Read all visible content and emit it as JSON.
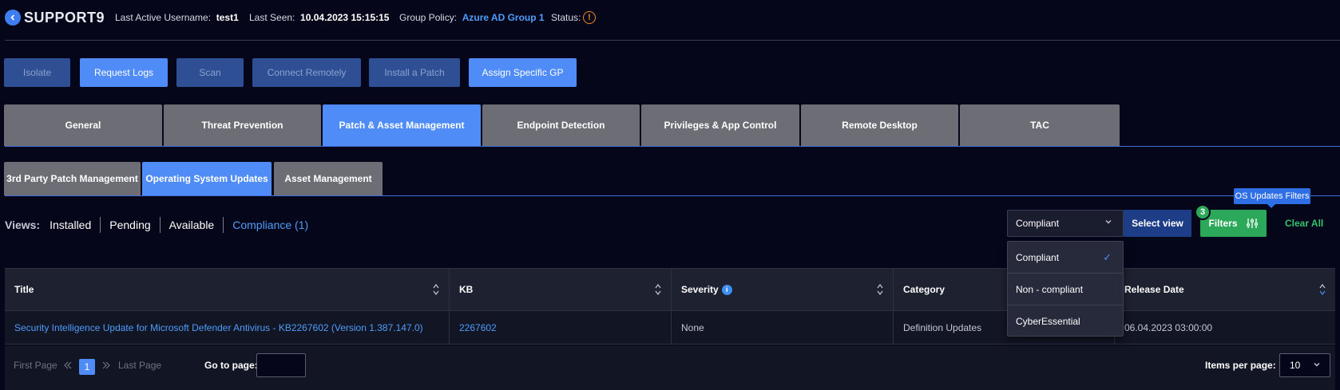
{
  "header": {
    "device_name": "SUPPORT9",
    "last_active_label": "Last Active Username:",
    "last_active_value": "test1",
    "last_seen_label": "Last Seen:",
    "last_seen_value": "10.04.2023  15:15:15",
    "group_policy_label": "Group Policy:",
    "group_policy_value": "Azure AD Group 1",
    "status_label": "Status:",
    "status_icon": "!"
  },
  "actions": {
    "isolate": "Isolate",
    "request_logs": "Request Logs",
    "scan": "Scan",
    "connect_remotely": "Connect Remotely",
    "install_patch": "Install a Patch",
    "assign_gp": "Assign Specific GP"
  },
  "tabs": [
    "General",
    "Threat Prevention",
    "Patch & Asset Management",
    "Endpoint Detection",
    "Privileges & App Control",
    "Remote Desktop",
    "TAC"
  ],
  "subtabs": {
    "third_party": "3rd Party Patch Management",
    "os_updates": "Operating System Updates",
    "asset_mgmt": "Asset Management"
  },
  "views": {
    "label": "Views:",
    "items": [
      "Installed",
      "Pending",
      "Available",
      "Compliance (1)"
    ]
  },
  "toolbar": {
    "select_value": "Compliant",
    "select_view": "Select view",
    "filters": "Filters",
    "filter_count": "3",
    "tooltip": "OS Updates Filters",
    "clear_all": "Clear All"
  },
  "dropdown": {
    "options": [
      "Compliant",
      "Non - compliant",
      "CyberEssential"
    ],
    "check": "✓"
  },
  "table": {
    "headers": [
      "Title",
      "KB",
      "Severity",
      "Category",
      "Release Date"
    ],
    "rows": [
      {
        "title": "Security Intelligence Update for Microsoft Defender Antivirus - KB2267602 (Version 1.387.147.0)",
        "kb": "2267602",
        "severity": "None",
        "category": "Definition Updates",
        "release_date": "06.04.2023  03:00:00"
      }
    ]
  },
  "pager": {
    "first": "First Page",
    "last": "Last Page",
    "current": "1",
    "goto_label": "Go to page:",
    "ipp_label": "Items per page:",
    "ipp_value": "10"
  }
}
